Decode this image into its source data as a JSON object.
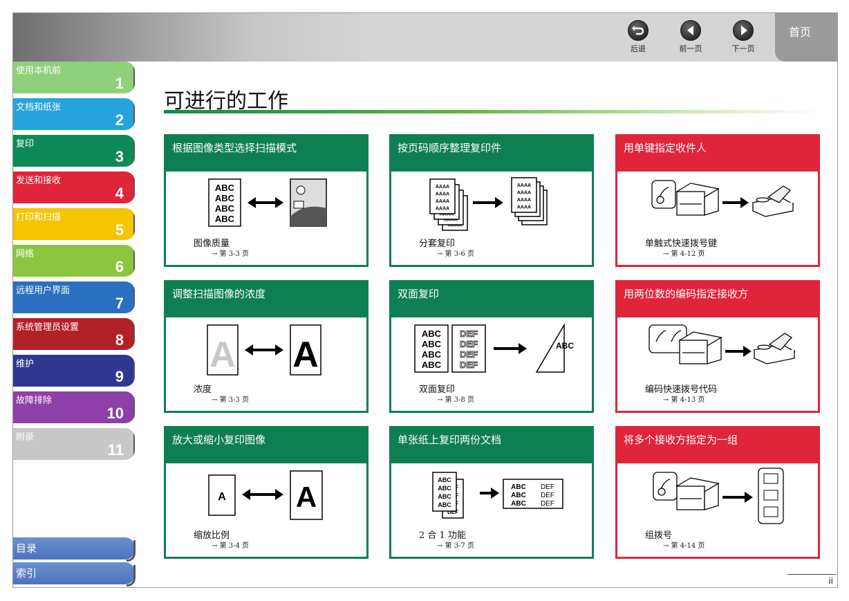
{
  "nav": {
    "back_label": "后退",
    "prev_label": "前一页",
    "next_label": "下一页",
    "home_label": "首页"
  },
  "sidebar": {
    "chapters": [
      {
        "label": "使用本机前",
        "num": "1",
        "color": "#8fd07a"
      },
      {
        "label": "文档和纸张",
        "num": "2",
        "color": "#27a3db"
      },
      {
        "label": "复印",
        "num": "3",
        "color": "#0e8a58"
      },
      {
        "label": "发送和接收",
        "num": "4",
        "color": "#e0243a"
      },
      {
        "label": "打印和扫描",
        "num": "5",
        "color": "#f6c400"
      },
      {
        "label": "网络",
        "num": "6",
        "color": "#8cc63f"
      },
      {
        "label": "远程用户界面",
        "num": "7",
        "color": "#2a6fc0"
      },
      {
        "label": "系统管理员设置",
        "num": "8",
        "color": "#b22028"
      },
      {
        "label": "维护",
        "num": "9",
        "color": "#2f3793"
      },
      {
        "label": "故障排除",
        "num": "10",
        "color": "#8e3fa8"
      },
      {
        "label": "附录",
        "num": "11",
        "color": "#c8c8c8"
      }
    ],
    "contents_label": "目录",
    "index_label": "索引"
  },
  "page": {
    "title": "可进行的工作",
    "number": "ii"
  },
  "cards": [
    {
      "title": "根据图像类型选择扫描模式",
      "caption": "图像质量",
      "ref": "→ 第 3-3 页",
      "theme": "green",
      "illus": "image-quality"
    },
    {
      "title": "按页码顺序整理复印件",
      "caption": "分套复印",
      "ref": "→ 第 3-6 页",
      "theme": "green",
      "illus": "collate"
    },
    {
      "title": "用单键指定收件人",
      "caption": "单触式快速拨号键",
      "ref": "→ 第 4-12 页",
      "theme": "red",
      "illus": "one-touch"
    },
    {
      "title": "调整扫描图像的浓度",
      "caption": "浓度",
      "ref": "→ 第 3-3 页",
      "theme": "green",
      "illus": "density"
    },
    {
      "title": "双面复印",
      "caption": "双面复印",
      "ref": "→ 第 3-8 页",
      "theme": "green",
      "illus": "two-sided"
    },
    {
      "title": "用两位数的编码指定接收方",
      "caption": "编码快速拨号代码",
      "ref": "→ 第 4-13 页",
      "theme": "red",
      "illus": "coded-dial"
    },
    {
      "title": "放大或缩小复印图像",
      "caption": "缩放比例",
      "ref": "→ 第 3-4 页",
      "theme": "green",
      "illus": "zoom"
    },
    {
      "title": "单张纸上复印两份文档",
      "caption": "2 合 1 功能",
      "ref": "→ 第 3-7 页",
      "theme": "green",
      "illus": "two-on-one"
    },
    {
      "title": "将多个接收方指定为一组",
      "caption": "组拨号",
      "ref": "→ 第 4-14 页",
      "theme": "red",
      "illus": "group-dial"
    }
  ],
  "illus_text": {
    "abc": "ABC",
    "def": "DEF",
    "aaaa": "AAAA",
    "a": "A"
  },
  "colors": {
    "green": "#0e7f52",
    "red": "#e0243a"
  }
}
